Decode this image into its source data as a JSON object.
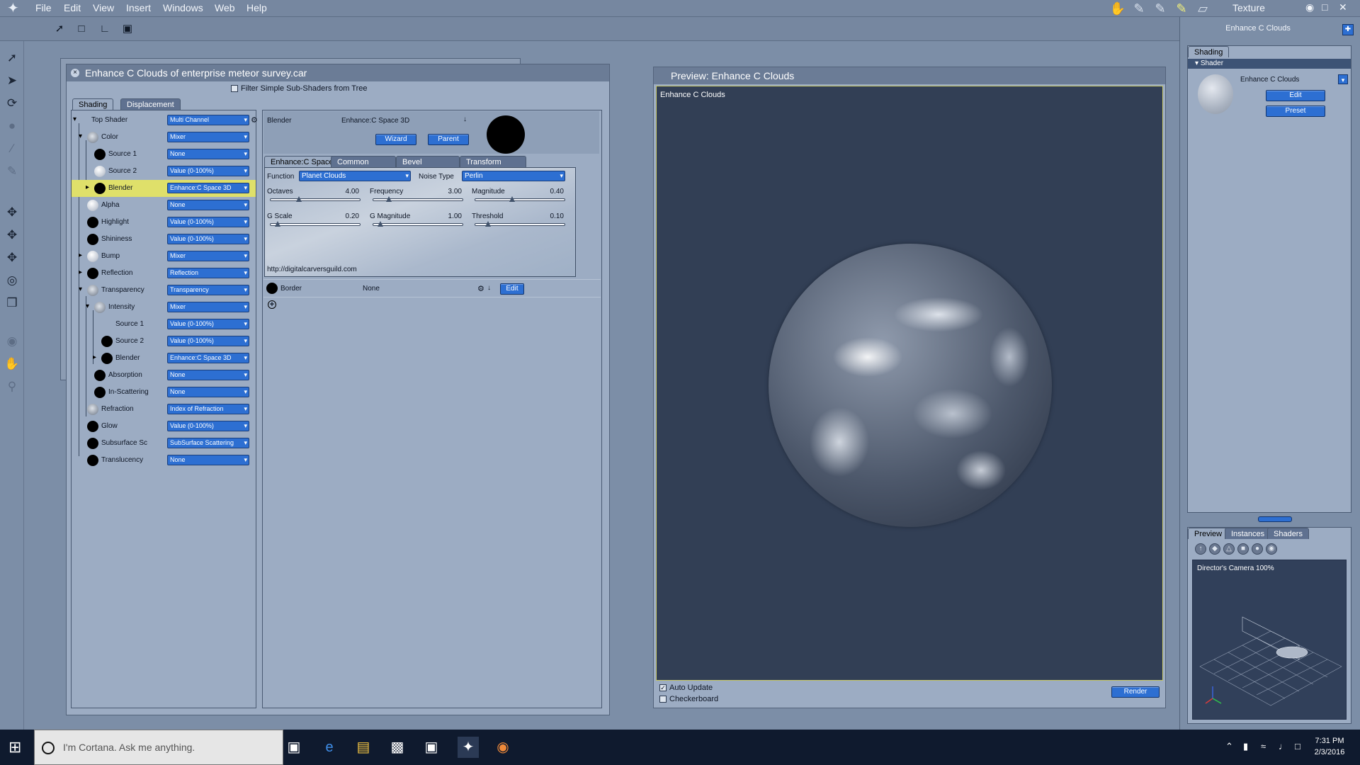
{
  "menubar": {
    "items": [
      "File",
      "Edit",
      "View",
      "Insert",
      "Windows",
      "Web",
      "Help"
    ],
    "room": "Texture"
  },
  "material_window": {
    "title": "Enhance C Clouds of enterprise meteor survey.car",
    "filter_label": "Filter Simple Sub-Shaders from Tree",
    "tabs": [
      "Shading",
      "Displacement"
    ],
    "tree": [
      {
        "label": "Top Shader",
        "value": "Multi Channel"
      },
      {
        "label": "Color",
        "value": "Mixer"
      },
      {
        "label": "Source 1",
        "value": "None"
      },
      {
        "label": "Source 2",
        "value": "Value (0-100%)"
      },
      {
        "label": "Blender",
        "value": "Enhance:C Space 3D"
      },
      {
        "label": "Alpha",
        "value": "None"
      },
      {
        "label": "Highlight",
        "value": "Value (0-100%)"
      },
      {
        "label": "Shininess",
        "value": "Value (0-100%)"
      },
      {
        "label": "Bump",
        "value": "Mixer"
      },
      {
        "label": "Reflection",
        "value": "Reflection"
      },
      {
        "label": "Transparency",
        "value": "Transparency"
      },
      {
        "label": "Intensity",
        "value": "Mixer"
      },
      {
        "label": "Source 1",
        "value": "Value (0-100%)"
      },
      {
        "label": "Source 2",
        "value": "Value (0-100%)"
      },
      {
        "label": "Blender",
        "value": "Enhance:C Space 3D"
      },
      {
        "label": "Absorption",
        "value": "None"
      },
      {
        "label": "In-Scattering",
        "value": "None"
      },
      {
        "label": "Refraction",
        "value": "Index of Refraction"
      },
      {
        "label": "Glow",
        "value": "Value (0-100%)"
      },
      {
        "label": "Subsurface Sc",
        "value": "SubSurface Scattering"
      },
      {
        "label": "Translucency",
        "value": "None"
      }
    ],
    "detail": {
      "channel": "Blender",
      "shader": "Enhance:C Space 3D",
      "wizard": "Wizard",
      "parent": "Parent",
      "tabs": [
        "Enhance:C Space",
        "Common",
        "Bevel",
        "Transform"
      ],
      "function_label": "Function",
      "function_value": "Planet Clouds",
      "noise_label": "Noise Type",
      "noise_value": "Perlin",
      "sliders": [
        {
          "label": "Octaves",
          "value": "4.00",
          "pos": 0.3
        },
        {
          "label": "Frequency",
          "value": "3.00",
          "pos": 0.15
        },
        {
          "label": "Magnitude",
          "value": "0.40",
          "pos": 0.4
        },
        {
          "label": "G Scale",
          "value": "0.20",
          "pos": 0.05
        },
        {
          "label": "G Magnitude",
          "value": "1.00",
          "pos": 0.05
        },
        {
          "label": "Threshold",
          "value": "0.10",
          "pos": 0.12
        }
      ],
      "url": "http://digitalcarversguild.com",
      "border_label": "Border",
      "border_value": "None",
      "edit": "Edit",
      "add": "+"
    }
  },
  "preview": {
    "title": "Preview: Enhance C Clouds",
    "label": "Enhance C Clouds",
    "auto_update": "Auto Update",
    "checkerboard": "Checkerboard",
    "render": "Render"
  },
  "right_panel": {
    "title": "Enhance C Clouds",
    "tab": "Shading",
    "section": "Shader",
    "shader_name": "Enhance C Clouds",
    "edit": "Edit",
    "preset": "Preset",
    "bottom_tabs": [
      "Preview",
      "Instances",
      "Shaders"
    ],
    "camera_label": "Director's Camera 100%"
  },
  "taskbar": {
    "cortana": "I'm Cortana. Ask me anything.",
    "time": "7:31 PM",
    "date": "2/3/2016"
  }
}
